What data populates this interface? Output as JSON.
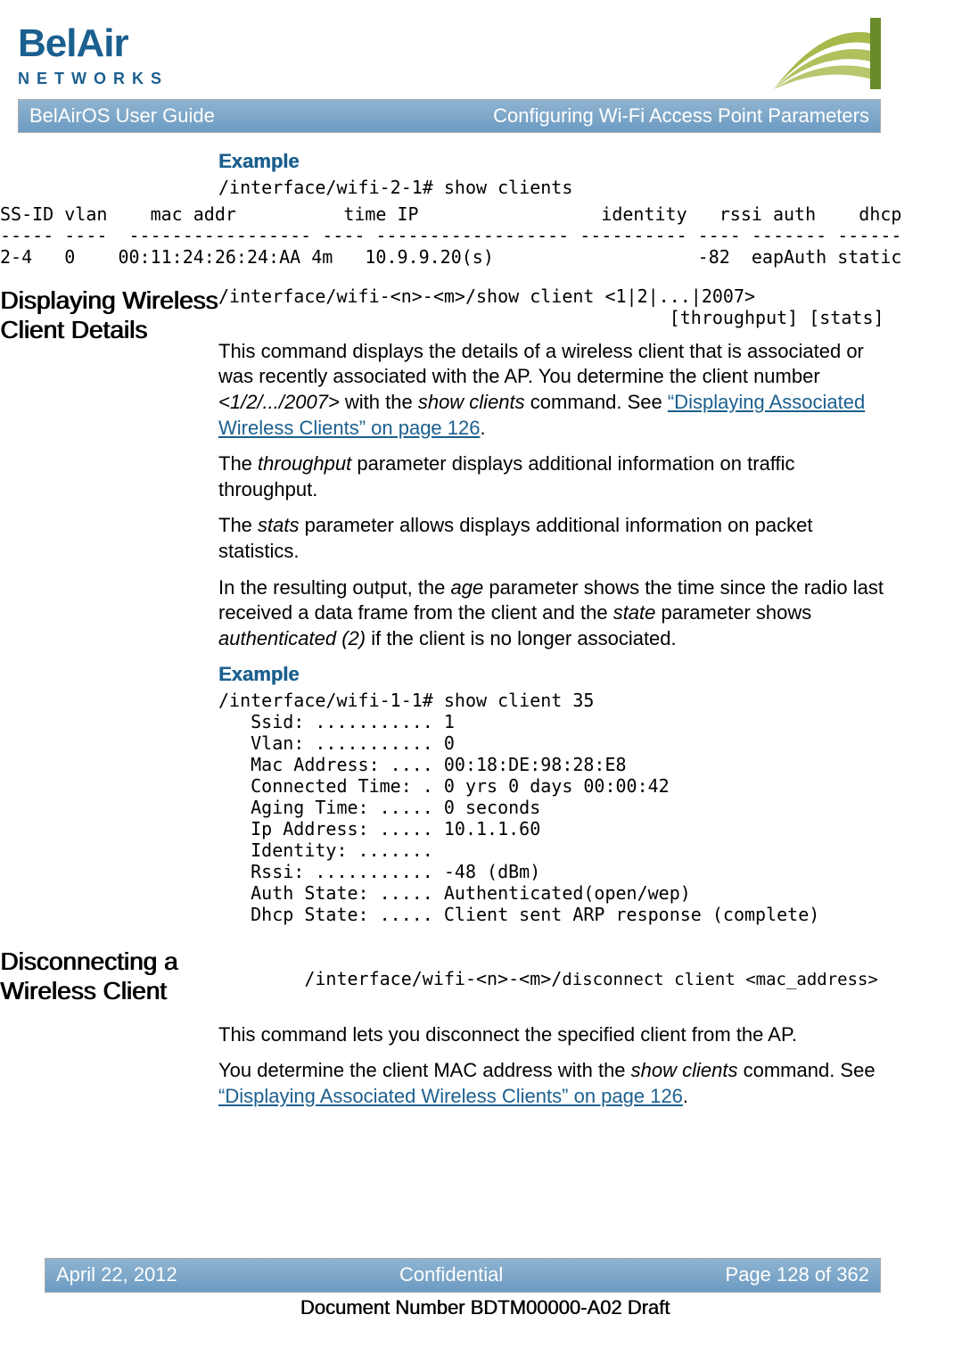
{
  "logo": {
    "top": "BelAir",
    "bottom": "NETWORKS"
  },
  "title_bar": {
    "left": "BelAirOS User Guide",
    "right": "Configuring Wi-Fi Access Point Parameters"
  },
  "example1": {
    "heading": "Example",
    "cmd": "/interface/wifi-2-1# show clients",
    "table": "SS-ID vlan    mac addr          time IP                 identity   rssi auth    dhcp\n----- ----  ----------------- ---- ------------------ ---------- ---- ------- ------\n2-4   0    00:11:24:26:24:AA 4m   10.9.9.20(s)                   -82  eapAuth static"
  },
  "section_display": {
    "heading": "Displaying Wireless Client Details",
    "syntax1": "/interface/wifi-<n>-<m>/show client <1|2|...|2007>",
    "syntax1b": "                                          [throughput] [stats]",
    "p1a": "This command displays the details of a wireless client that is associated or was recently associated with the AP. You determine the client number ",
    "p1_range": "<1/2/.../2007>",
    "p1b": " with the ",
    "p1_cmd": "show clients",
    "p1c": " command. See ",
    "p1_link": "“Displaying Associated Wireless Clients” on page 126",
    "p1d": ".",
    "p2a": "The ",
    "p2_term": "throughput",
    "p2b": " parameter displays additional information on traffic throughput.",
    "p3a": "The ",
    "p3_term": "stats",
    "p3b": " parameter allows displays additional information on packet statistics.",
    "p4a": "In the resulting output, the ",
    "p4_age": "age",
    "p4b": " parameter shows the time since the radio last received a data frame from the client and the ",
    "p4_state": "state",
    "p4c": " parameter shows ",
    "p4_auth": "authenticated (2)",
    "p4d": " if the client is no longer associated.",
    "example_heading": "Example",
    "example_block": "/interface/wifi-1-1# show client 35\n   Ssid: ........... 1\n   Vlan: ........... 0\n   Mac Address: .... 00:18:DE:98:28:E8\n   Connected Time: . 0 yrs 0 days 00:00:42\n   Aging Time: ..... 0 seconds\n   Ip Address: ..... 10.1.1.60\n   Identity: .......\n   Rssi: ........... -48 (dBm)\n   Auth State: ..... Authenticated(open/wep)\n   Dhcp State: ..... Client sent ARP response (complete)"
  },
  "section_disconnect": {
    "heading": "Disconnecting a Wireless Client",
    "syntax_pre": "/interface/wifi-<n>-<m>/",
    "syntax_cmd": "disconnect client <mac_address>",
    "p1": "This command lets you disconnect the specified client from the AP.",
    "p2a": "You determine the client MAC address with the ",
    "p2_cmd": "show clients",
    "p2b": " command. See ",
    "p2_link": "“Displaying Associated Wireless Clients” on page 126",
    "p2c": "."
  },
  "footer": {
    "left": "April 22, 2012",
    "center": "Confidential",
    "right": "Page 128 of 362"
  },
  "docnum": "Document Number BDTM00000-A02 Draft"
}
